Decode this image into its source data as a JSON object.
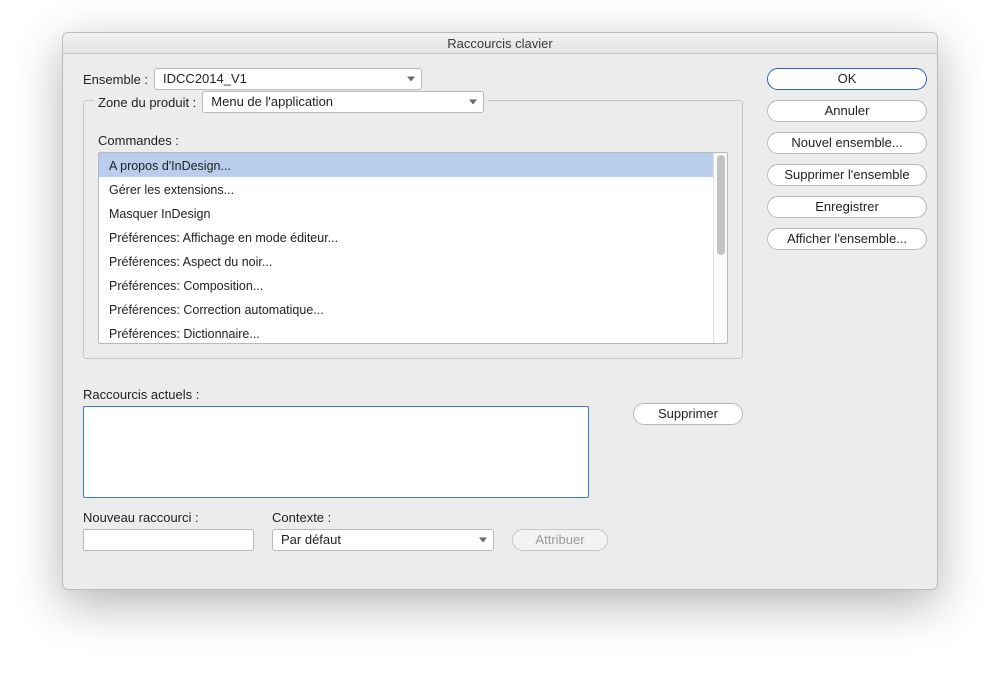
{
  "window": {
    "title": "Raccourcis clavier"
  },
  "ensemble": {
    "label": "Ensemble :",
    "value": "IDCC2014_V1"
  },
  "zone": {
    "label": "Zone du produit :",
    "value": "Menu de l'application"
  },
  "commands": {
    "label": "Commandes :",
    "items": [
      "A propos d'InDesign...",
      "Gérer les extensions...",
      "Masquer InDesign",
      "Préférences: Affichage en mode éditeur...",
      "Préférences: Aspect du noir...",
      "Préférences: Composition...",
      "Préférences: Correction automatique...",
      "Préférences: Dictionnaire..."
    ],
    "selected_index": 0
  },
  "current": {
    "label": "Raccourcis actuels :",
    "delete_label": "Supprimer"
  },
  "new_shortcut": {
    "label": "Nouveau raccourci :"
  },
  "context": {
    "label": "Contexte :",
    "value": "Par défaut"
  },
  "assign": {
    "label": "Attribuer"
  },
  "side": {
    "ok": "OK",
    "cancel": "Annuler",
    "new_set": "Nouvel ensemble...",
    "delete_set": "Supprimer l'ensemble",
    "save": "Enregistrer",
    "show_set": "Afficher l'ensemble..."
  }
}
